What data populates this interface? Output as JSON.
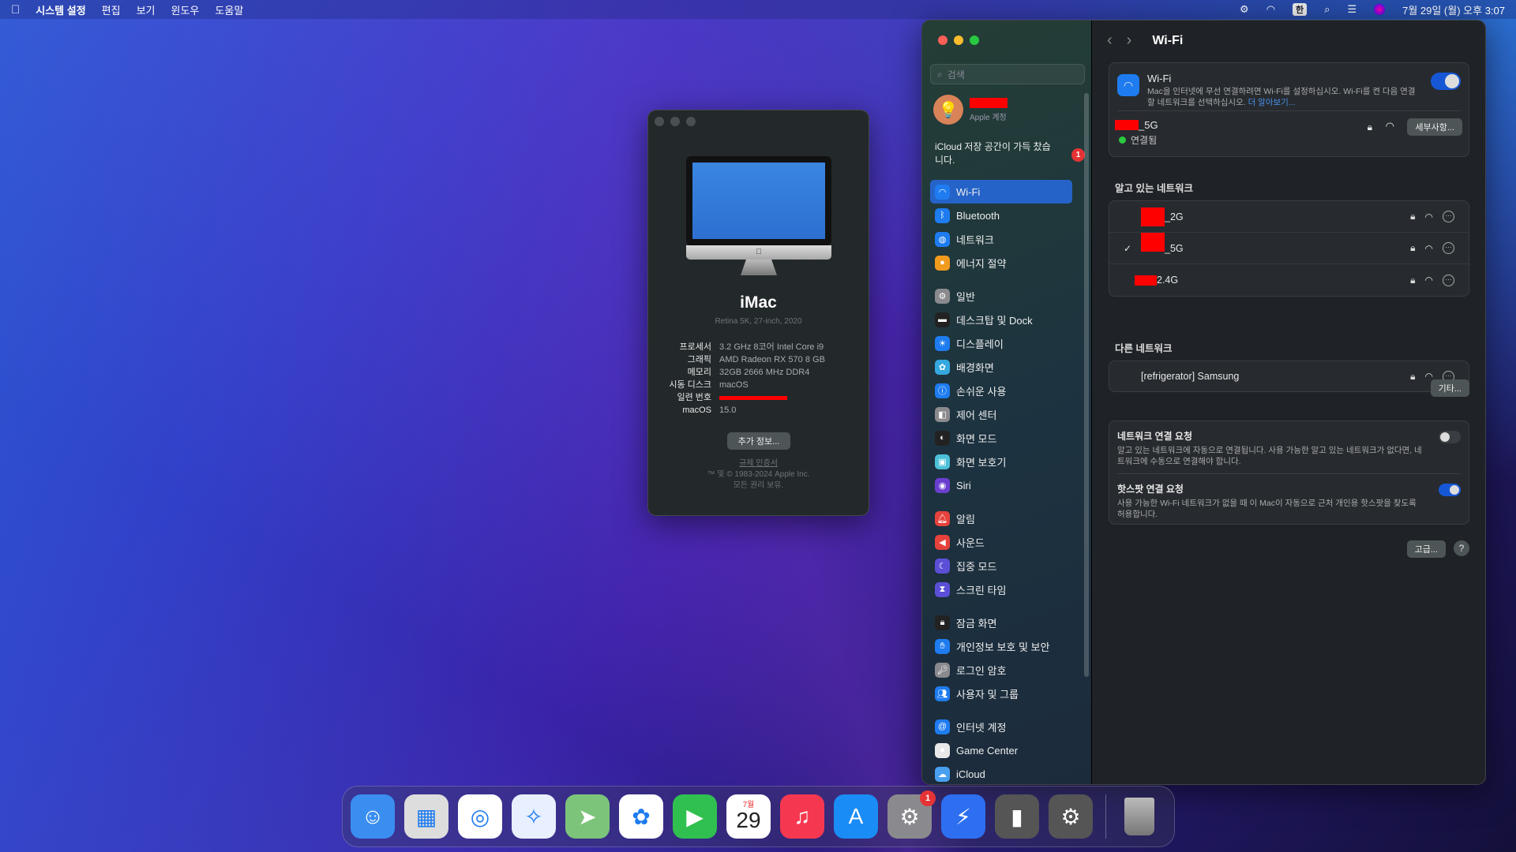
{
  "menubar": {
    "app": "시스템 설정",
    "menus": [
      "편집",
      "보기",
      "윈도우",
      "도움말"
    ],
    "input_method": "한",
    "clock": "7월 29일 (월) 오후 3:07"
  },
  "about": {
    "model": "iMac",
    "subtitle": "Retina 5K, 27-inch, 2020",
    "specs": [
      {
        "k": "프로세서",
        "v": "3.2 GHz 8코어 Intel Core i9"
      },
      {
        "k": "그래픽",
        "v": "AMD Radeon RX 570 8 GB"
      },
      {
        "k": "메모리",
        "v": "32GB 2666 MHz DDR4"
      },
      {
        "k": "시동 디스크",
        "v": "macOS"
      },
      {
        "k": "일련 번호",
        "v": ""
      },
      {
        "k": "macOS",
        "v": "15.0"
      }
    ],
    "more_button": "추가 정보...",
    "regulatory": "규제 인증서",
    "copyright": "™ 및 © 1983-2024 Apple Inc.",
    "rights": "모든 권리 보유."
  },
  "sidebar": {
    "search_placeholder": "검색",
    "account_label": "Apple 계정",
    "icloud_notice": "iCloud 저장 공간이 가득 찼습니다.",
    "icloud_badge": "1",
    "groups": [
      [
        {
          "label": "Wi-Fi",
          "icon": "wifi",
          "color": "#1e7cf0",
          "selected": true
        },
        {
          "label": "Bluetooth",
          "icon": "bluetooth",
          "color": "#1e7cf0"
        },
        {
          "label": "네트워크",
          "icon": "globe",
          "color": "#1e7cf0"
        },
        {
          "label": "에너지 절약",
          "icon": "bulb",
          "color": "#f09a1e"
        }
      ],
      [
        {
          "label": "일반",
          "icon": "gear",
          "color": "#8a8a8e"
        },
        {
          "label": "데스크탑 및 Dock",
          "icon": "dock",
          "color": "#222"
        },
        {
          "label": "디스플레이",
          "icon": "sun",
          "color": "#1e7cf0"
        },
        {
          "label": "배경화면",
          "icon": "flower",
          "color": "#35a8e0"
        },
        {
          "label": "손쉬운 사용",
          "icon": "accessibility",
          "color": "#1e7cf0"
        },
        {
          "label": "제어 센터",
          "icon": "switches",
          "color": "#8a8a8e"
        },
        {
          "label": "화면 모드",
          "icon": "appearance",
          "color": "#222"
        },
        {
          "label": "화면 보호기",
          "icon": "screensaver",
          "color": "#4cc0d8"
        },
        {
          "label": "Siri",
          "icon": "siri",
          "color": "#6a3fd0"
        }
      ],
      [
        {
          "label": "알림",
          "icon": "bell",
          "color": "#e6423c"
        },
        {
          "label": "사운드",
          "icon": "speaker",
          "color": "#e6423c"
        },
        {
          "label": "집중 모드",
          "icon": "moon",
          "color": "#5a4fd6"
        },
        {
          "label": "스크린 타임",
          "icon": "hourglass",
          "color": "#5a4fd6"
        }
      ],
      [
        {
          "label": "잠금 화면",
          "icon": "lock",
          "color": "#222"
        },
        {
          "label": "개인정보 보호 및 보안",
          "icon": "hand",
          "color": "#1e7cf0"
        },
        {
          "label": "로그인 암호",
          "icon": "key",
          "color": "#8a8a8e"
        },
        {
          "label": "사용자 및 그룹",
          "icon": "users",
          "color": "#1e7cf0"
        }
      ],
      [
        {
          "label": "인터넷 계정",
          "icon": "at",
          "color": "#1e7cf0"
        },
        {
          "label": "Game Center",
          "icon": "gamecenter",
          "color": "#e8e8e8"
        },
        {
          "label": "iCloud",
          "icon": "cloud",
          "color": "#4aa0f0"
        }
      ]
    ]
  },
  "wifi": {
    "title": "Wi-Fi",
    "card_title": "Wi-Fi",
    "enabled": true,
    "desc": "Mac을 인터넷에 무선 연결하려면 Wi-Fi를 설정하십시오. Wi-Fi를 켠 다음 연결할 네트워크를 선택하십시오.",
    "learn_more": "더 알아보기...",
    "current": {
      "name_suffix": "_5G",
      "status": "연결됨",
      "details_button": "세부사항..."
    },
    "known_header": "알고 있는 네트워크",
    "known": [
      {
        "name_suffix": "_2G",
        "checked": false
      },
      {
        "name_suffix": "_5G",
        "checked": true
      },
      {
        "name_suffix": "2.4G",
        "checked": false
      }
    ],
    "other_header": "다른 네트워크",
    "other": [
      {
        "name": "[refrigerator] Samsung"
      }
    ],
    "other_button": "기타...",
    "ask_join": {
      "title": "네트워크 연결 요청",
      "desc": "알고 있는 네트워크에 자동으로 연결됩니다. 사용 가능한 알고 있는 네트워크가 없다면, 네트워크에 수동으로 연결해야 합니다.",
      "enabled": false
    },
    "ask_hotspot": {
      "title": "핫스팟 연결 요청",
      "desc": "사용 가능한 Wi-Fi 네트워크가 없을 때 이 Mac이 자동으로 근처 개인용 핫스팟을 찾도록 허용합니다.",
      "enabled": true
    },
    "advanced_button": "고급...",
    "help_button": "?",
    "check": "✓"
  },
  "dock": {
    "apps": [
      {
        "name": "Finder",
        "color": "#3a8ef0"
      },
      {
        "name": "Launchpad",
        "color": "#ddd"
      },
      {
        "name": "Chrome",
        "color": "#fff"
      },
      {
        "name": "Safari",
        "color": "#e8f0ff"
      },
      {
        "name": "Maps",
        "color": "#7cc47a"
      },
      {
        "name": "Photos",
        "color": "#fff"
      },
      {
        "name": "FaceTime",
        "color": "#30c050"
      },
      {
        "name": "Calendar",
        "color": "#fff",
        "month": "7월",
        "day": "29"
      },
      {
        "name": "Music",
        "color": "#f53850"
      },
      {
        "name": "App Store",
        "color": "#1a8cf5"
      },
      {
        "name": "System Settings",
        "color": "#8a8a8e",
        "badge": "1"
      },
      {
        "name": "Instruments",
        "color": "#2d6ff0"
      },
      {
        "name": "iPhone Mirroring",
        "color": "#555"
      },
      {
        "name": "Utility",
        "color": "#555"
      }
    ],
    "trash": "Trash"
  }
}
